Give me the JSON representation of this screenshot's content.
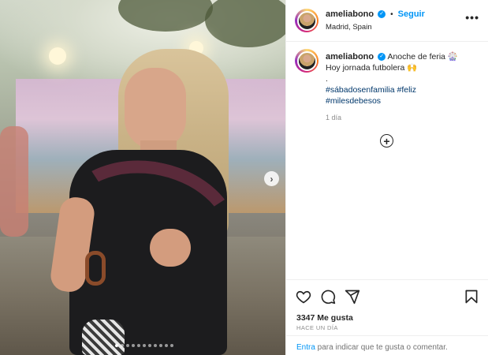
{
  "post": {
    "username": "ameliabono",
    "follow_label": "Seguir",
    "separator": "•",
    "location": "Madrid, Spain",
    "more_label": "•••"
  },
  "caption": {
    "username": "ameliabono",
    "line1": "Anoche de feria 🎡",
    "line2": "Hoy jornada futbolera 🙌",
    "line3": ".",
    "hashtags": [
      "#sábadosenfamilia",
      "#feliz",
      "#milesdebesos"
    ],
    "time": "1 día"
  },
  "stats": {
    "likes": "3347 Me gusta",
    "posted": "HACE UN DÍA"
  },
  "comment": {
    "enter": "Entra",
    "rest": " para indicar que te gusta o comentar."
  },
  "carousel": {
    "next_label": "›",
    "total_slides": 11,
    "active_slide": 1
  },
  "icons": [
    "heart-icon",
    "comment-icon",
    "share-icon",
    "bookmark-icon",
    "add-comment-icon",
    "verified-icon"
  ],
  "colors": {
    "accent": "#0095f6",
    "hashtag": "#00376b",
    "muted": "#8e8e8e"
  }
}
